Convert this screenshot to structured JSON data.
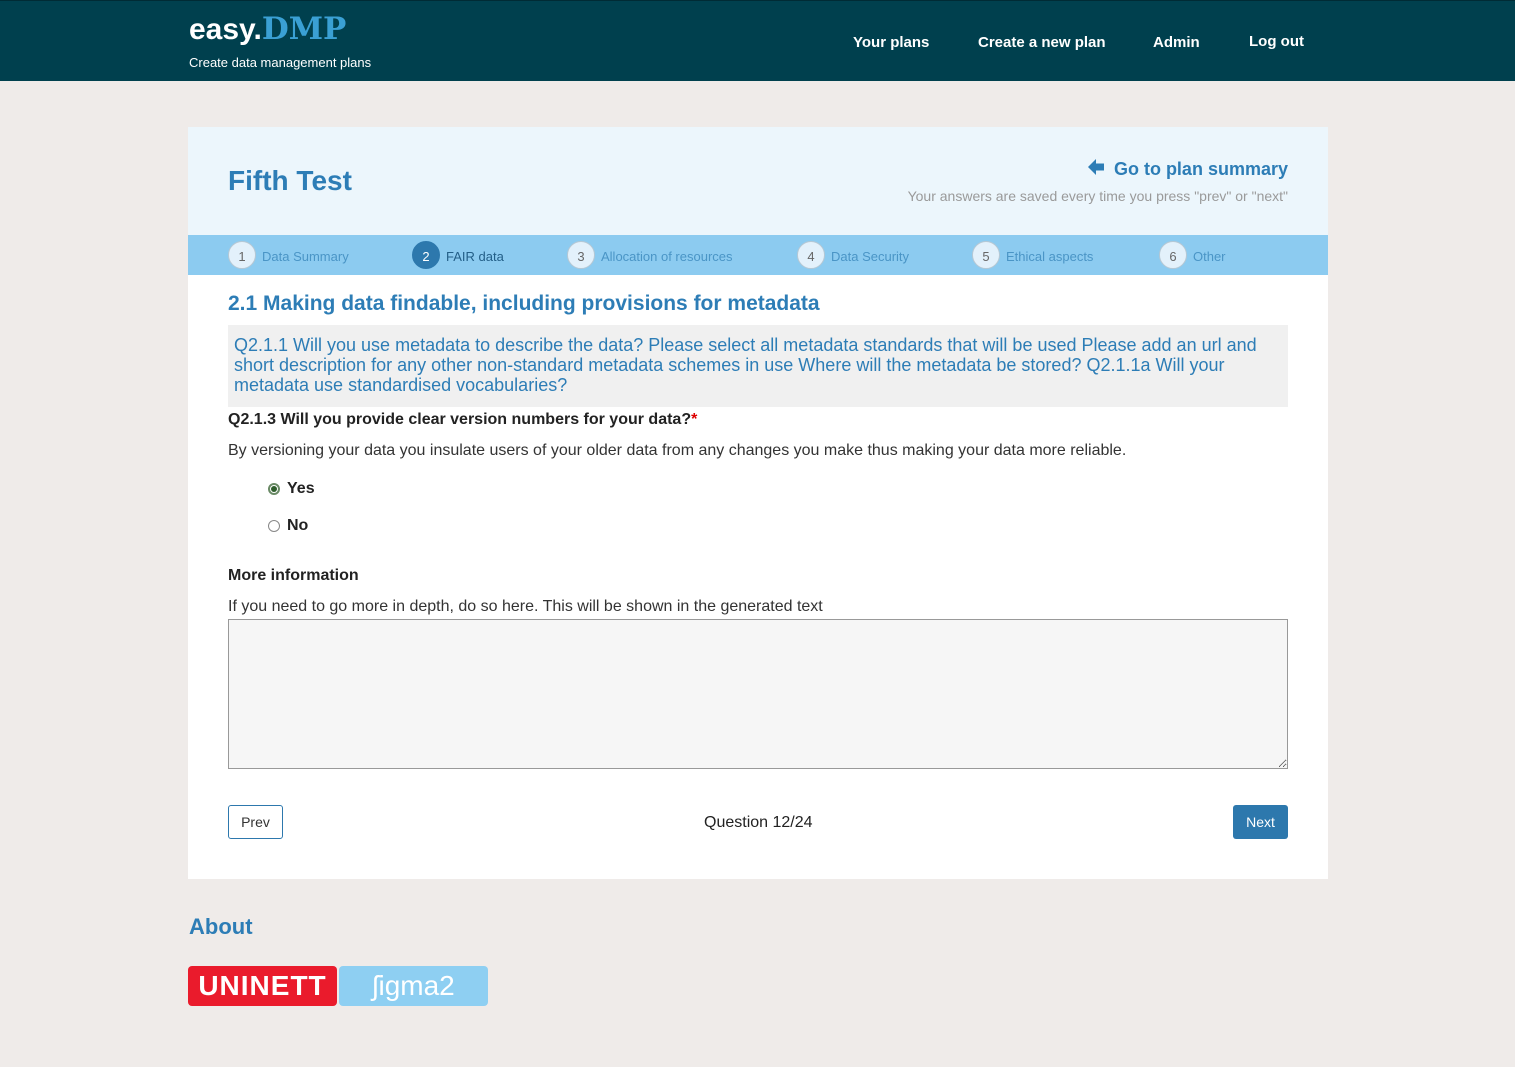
{
  "header": {
    "brand_easy": "easy.",
    "brand_dmp": "DMP",
    "tagline": "Create data management plans",
    "nav": [
      "Your plans",
      "Create a new plan",
      "Admin",
      "Log out"
    ]
  },
  "plan": {
    "title": "Fifth Test",
    "summary_link": "Go to plan summary",
    "saved_note": "Your answers are saved every time you press \"prev\" or \"next\""
  },
  "steps": [
    {
      "num": "1",
      "label": "Data Summary"
    },
    {
      "num": "2",
      "label": "FAIR data"
    },
    {
      "num": "3",
      "label": "Allocation of resources"
    },
    {
      "num": "4",
      "label": "Data Security"
    },
    {
      "num": "5",
      "label": "Ethical aspects"
    },
    {
      "num": "6",
      "label": "Other"
    }
  ],
  "active_step": "2",
  "section_title": "2.1 Making data findable, including provisions for metadata",
  "question_context": "Q2.1.1 Will you use metadata to describe the data? Please select all metadata standards that will be used Please add an url and short description for any other non-standard metadata schemes in use Where will the metadata be stored? Q2.1.1a Will your metadata use standardised vocabularies?",
  "question": {
    "label": "Q2.1.3 Will you provide clear version numbers for your data?",
    "required_mark": "*",
    "help": "By versioning your data you insulate users of your older data from any changes you make thus making your data more reliable.",
    "options": [
      "Yes",
      "No"
    ],
    "selected": "Yes"
  },
  "more_info": {
    "label": "More information",
    "help": "If you need to go more in depth, do so here. This will be shown in the generated text",
    "value": ""
  },
  "pager": {
    "prev": "Prev",
    "next": "Next",
    "counter": "Question 12/24"
  },
  "footer": {
    "about": "About",
    "logo_uninett": "UNINETT",
    "logo_sigma": "ʃigma2"
  },
  "colors": {
    "topbar": "#00404e",
    "accent": "#2d7db6",
    "step_bar": "#8ccbf0",
    "uninett_red": "#ea1b2c",
    "sigma_blue": "#8ecff2"
  }
}
